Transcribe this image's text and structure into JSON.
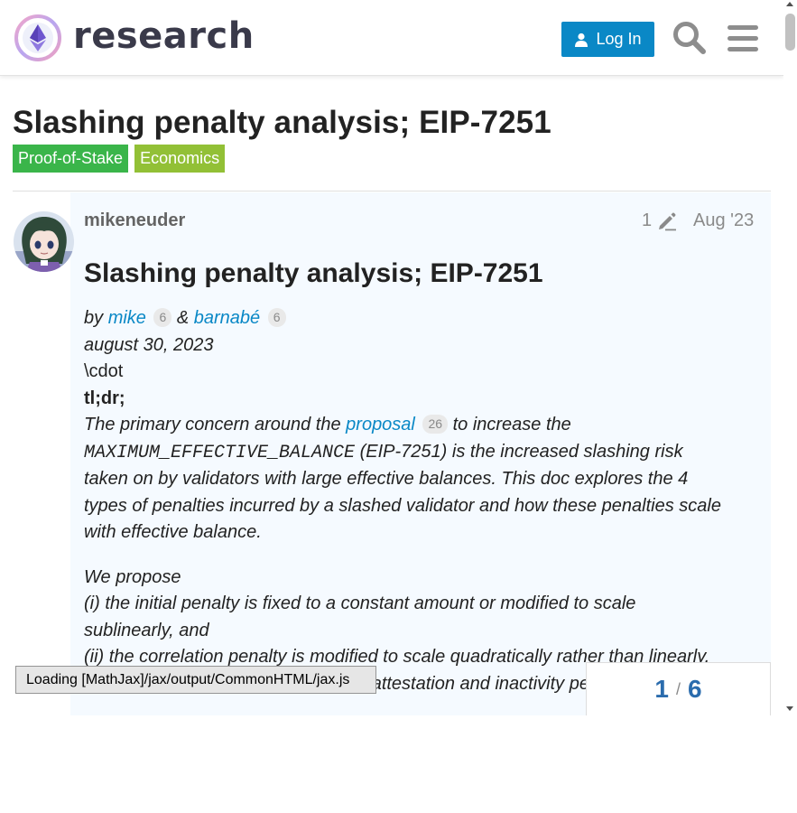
{
  "header": {
    "logo_text": "research",
    "login_label": "Log In"
  },
  "topic": {
    "title": "Slashing penalty analysis; EIP-7251",
    "tags": [
      "Proof-of-Stake",
      "Economics"
    ]
  },
  "post": {
    "author": "mikeneuder",
    "edit_count": "1",
    "date": "Aug '23",
    "heading": "Slashing penalty analysis; EIP-7251",
    "byline_by": "by",
    "author1": "mike",
    "author1_badge": "6",
    "amp": "&",
    "author2": "barnabé",
    "author2_badge": "6",
    "date_line": "august 30, 2023",
    "cdot": "\\cdot",
    "tldr": "tl;dr;",
    "p1_start": "The primary concern around the",
    "p1_link": "proposal",
    "p1_badge": "26",
    "p1_after_link": "to increase the",
    "p1_code": "MAXIMUM_EFFECTIVE_BALANCE",
    "p1_after_code": "(EIP-7251) is the increased slashing risk",
    "p1_line3": "taken on by validators with large effective balances. This doc explores the 4",
    "p1_line4": "types of penalties incurred by a slashed validator and how these penalties scale",
    "p1_line5": "with effective balance.",
    "p2_line1": "We propose",
    "p2_line2": "(i) the initial penalty is fixed to a constant amount or modified to scale",
    "p2_line3": "sublinearly, and",
    "p2_line4": "(ii) the correlation penalty is modified to scale quadratically rather than linearly.",
    "p2_line5": "Conversely, we suggest leaving the attestation and inactivity penalties unchanged."
  },
  "overlay": {
    "mathjax_status": "Loading [MathJax]/jax/output/CommonHTML/jax.js",
    "progress_current": "1",
    "progress_sep": "/",
    "progress_total": "6"
  }
}
